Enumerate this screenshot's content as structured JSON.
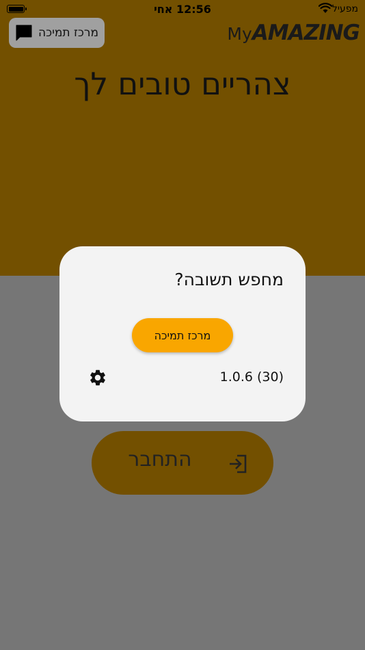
{
  "status_bar": {
    "time": "12:56 אחי",
    "carrier": "מפעיל",
    "icons": [
      "battery-icon",
      "wifi-icon"
    ]
  },
  "header": {
    "support_chip_label": "מרכז תמיכה",
    "brand_prefix": "My",
    "brand_name": "AMAZING"
  },
  "greeting": "צהריים טובים לך",
  "login": {
    "label": "התחבר",
    "icon": "login-icon"
  },
  "dialog": {
    "title": "מחפש תשובה?",
    "support_button_label": "מרכז תמיכה",
    "version": "1.0.6 (30)",
    "settings_icon": "gear-icon"
  },
  "colors": {
    "header_bg": "#735000",
    "overlay_bg": "#767676",
    "accent": "#f9a600",
    "dialog_bg": "#f3f3f3"
  }
}
